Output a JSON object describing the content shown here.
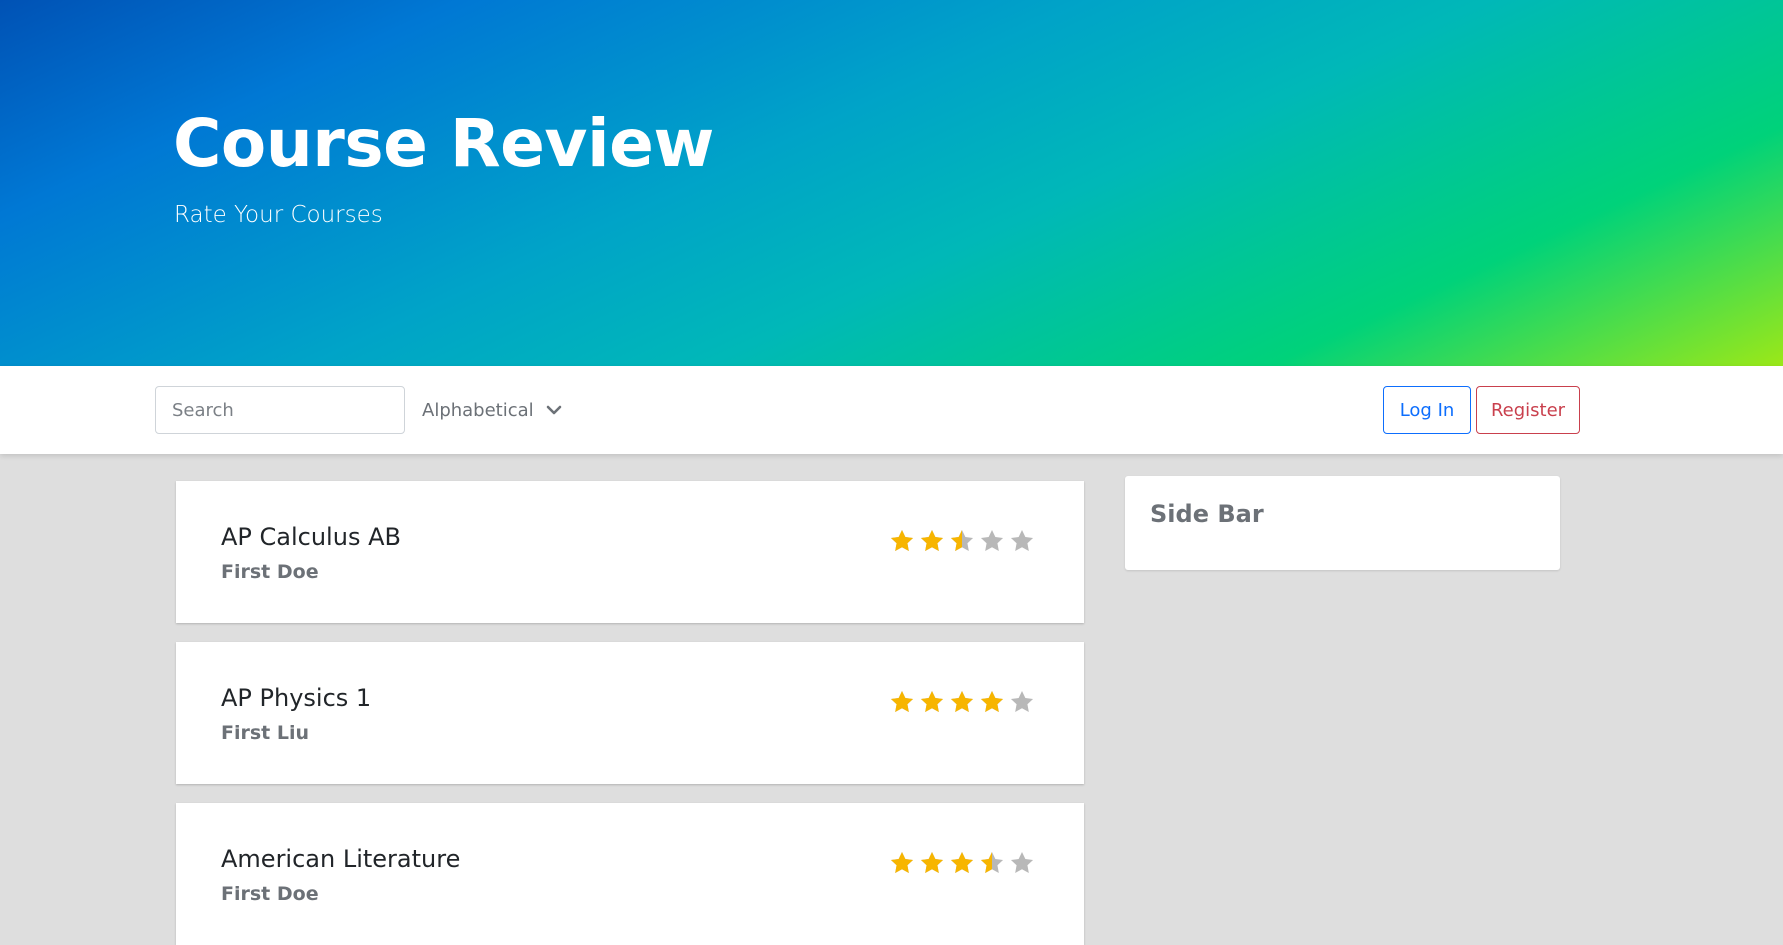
{
  "header": {
    "title": "Course Review",
    "subtitle": "Rate Your Courses"
  },
  "toolbar": {
    "search_placeholder": "Search",
    "sort_value": "Alphabetical",
    "login_label": "Log In",
    "register_label": "Register"
  },
  "courses": [
    {
      "name": "AP Calculus AB",
      "teacher": "First Doe",
      "rating": 2.5,
      "max_rating": 5
    },
    {
      "name": "AP Physics 1",
      "teacher": "First Liu",
      "rating": 4,
      "max_rating": 5
    },
    {
      "name": "American Literature",
      "teacher": "First Doe",
      "rating": 3.5,
      "max_rating": 5
    }
  ],
  "sidebar": {
    "title": "Side Bar"
  },
  "colors": {
    "star_filled": "#f7b500",
    "star_empty": "#b8b8b8",
    "login": "#0d6efd",
    "register": "#c9404d"
  },
  "icons": {
    "sort": "chevron-down-icon",
    "rating": "star-icon"
  }
}
